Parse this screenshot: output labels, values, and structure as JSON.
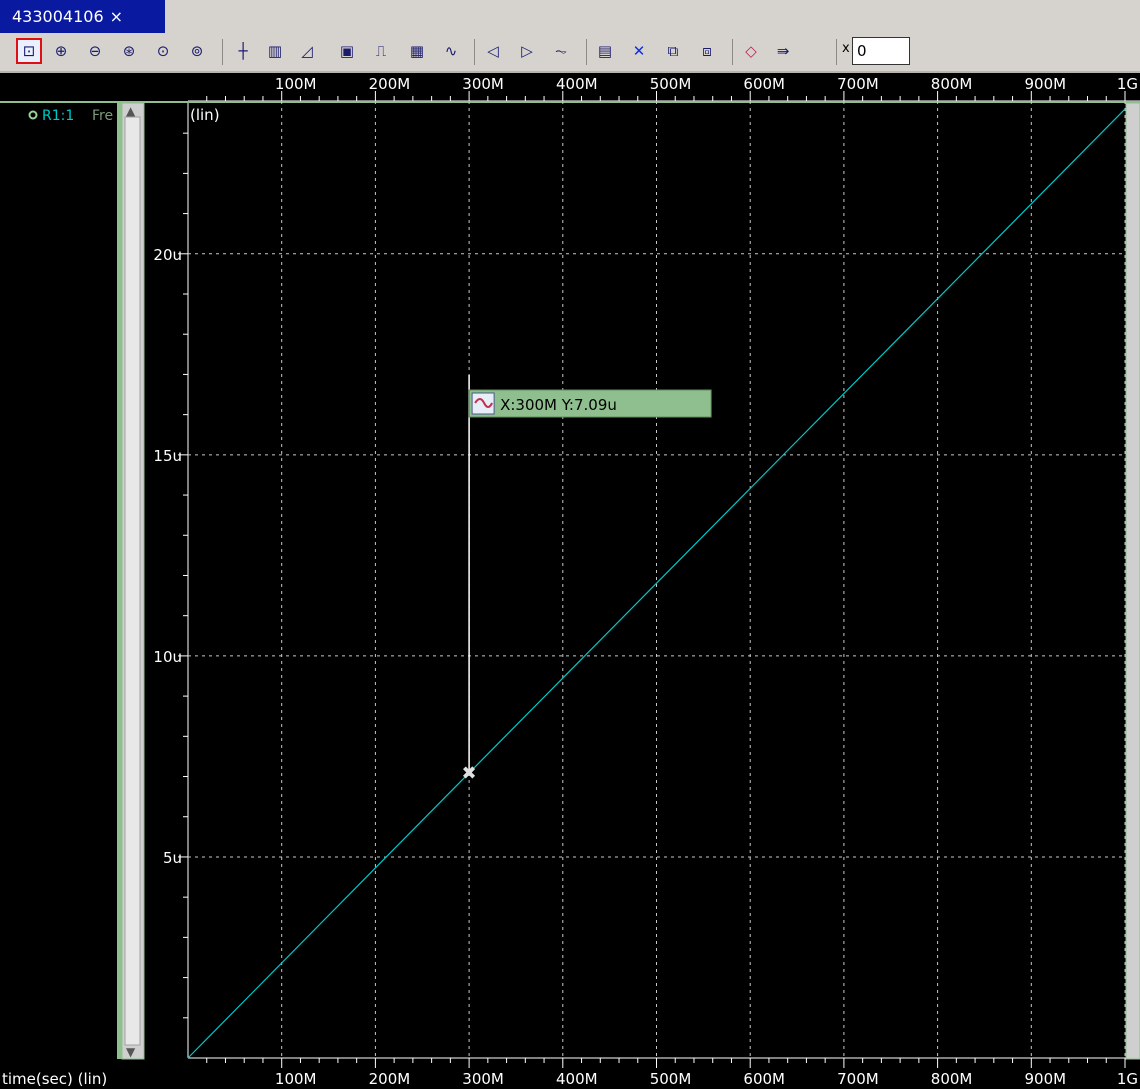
{
  "tab": {
    "title": "433004106",
    "close_symbol": "×"
  },
  "toolbar": {
    "icons": [
      "zoom-fit-icon",
      "zoom-in-icon",
      "zoom-out-icon",
      "zoom-xy-icon",
      "zoom-undo-icon",
      "zoom-redo-icon",
      "cursor-cross-icon",
      "bars-icon",
      "measure-icon",
      "annotation-icon",
      "pulse-icon",
      "grid-icon",
      "waveform-icon",
      "prev-icon",
      "next-icon",
      "waveform-marker-icon",
      "panel-icon",
      "delete-icon",
      "copy-icon",
      "paste-icon",
      "eraser-icon",
      "export-icon"
    ],
    "x_label": "x",
    "x_value": "0"
  },
  "signal": {
    "name": "R1:1",
    "suffix": "Fre",
    "color": "#00c8c8"
  },
  "marker": {
    "label": "X:300M Y:7.09u"
  },
  "chart_data": {
    "type": "line",
    "xlabel": "time(sec) (lin)",
    "ylabel": "(lin)",
    "xlim": [
      0,
      1000000000
    ],
    "ylim": [
      0,
      23.8
    ],
    "x_ticks": [
      "100M",
      "200M",
      "300M",
      "400M",
      "500M",
      "600M",
      "700M",
      "800M",
      "900M",
      "1G"
    ],
    "y_ticks": [
      "5u",
      "10u",
      "15u",
      "20u"
    ],
    "grid": true,
    "series": [
      {
        "name": "R1:1",
        "color": "#00c8c8",
        "x": [
          0,
          300000000,
          1000000000
        ],
        "y": [
          0,
          7.09,
          23.6
        ]
      }
    ],
    "marker_point": {
      "x": 300000000,
      "y": 7.09
    }
  }
}
